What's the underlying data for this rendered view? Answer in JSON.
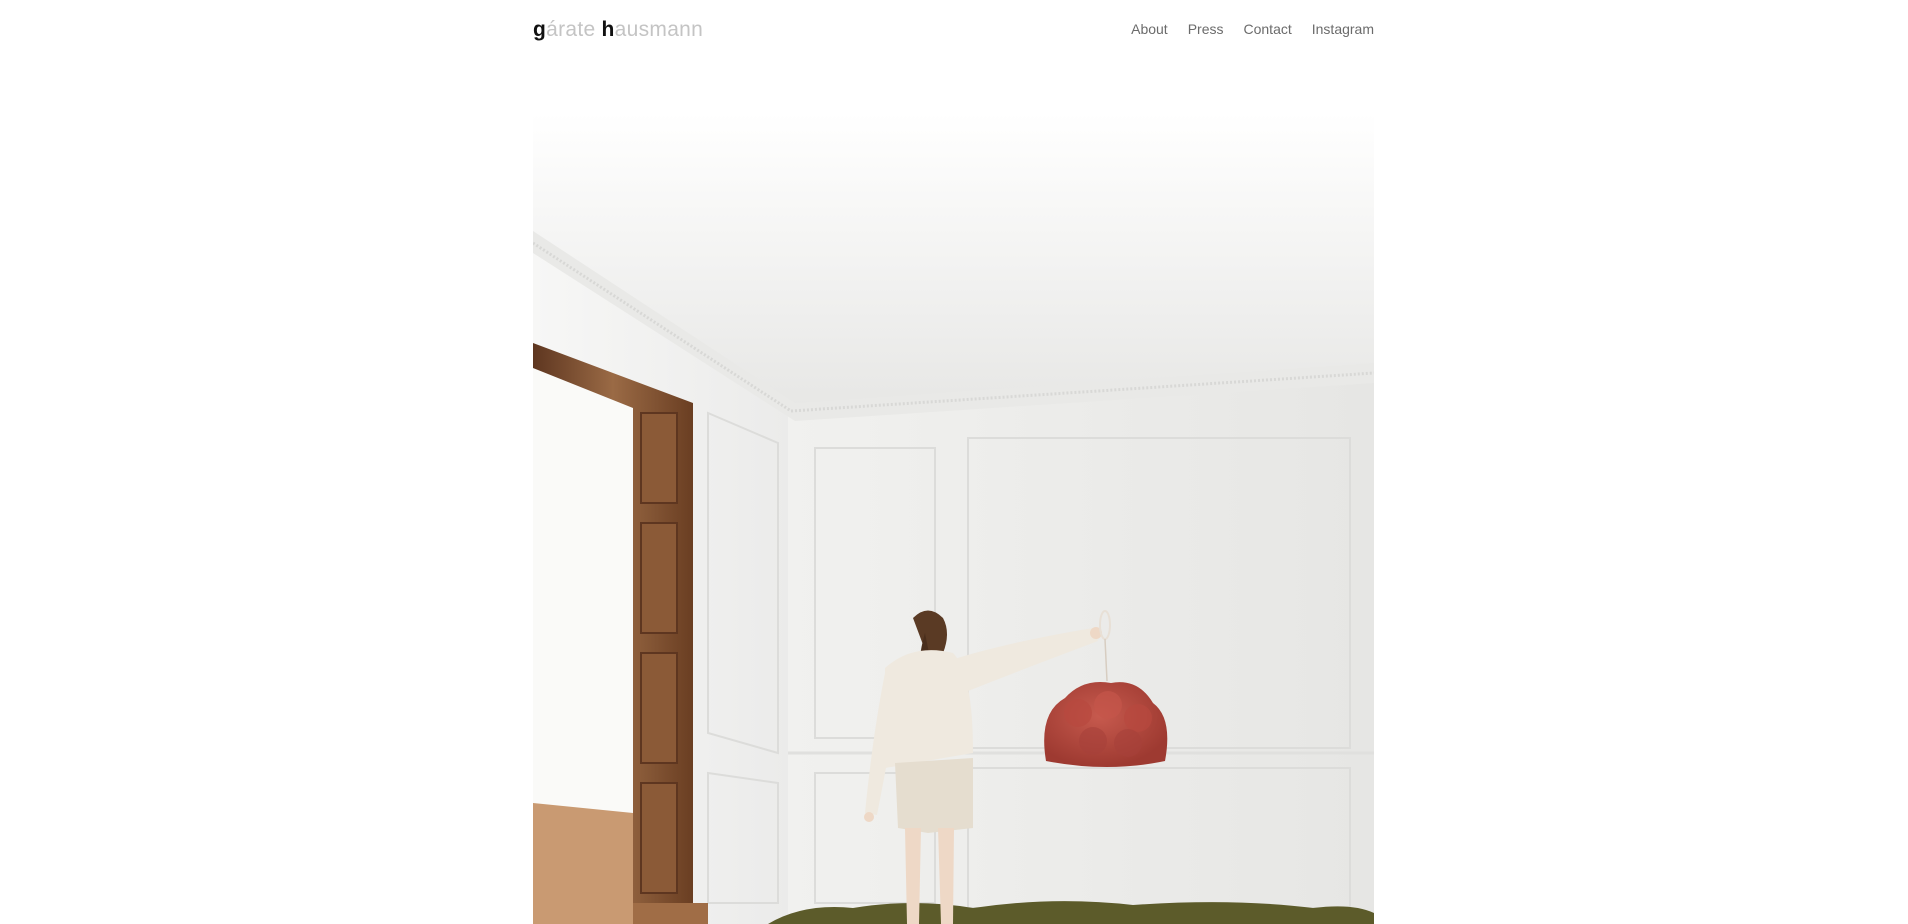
{
  "logo": {
    "first_initial": "g",
    "first_rest": "árate",
    "second_initial": "h",
    "second_rest": "ausmann",
    "initial_color": "#111111",
    "rest_color": "#c4c4c4"
  },
  "nav": {
    "items": [
      {
        "label": "About"
      },
      {
        "label": "Press"
      },
      {
        "label": "Contact"
      },
      {
        "label": "Instagram"
      }
    ],
    "color": "#6b6b6b"
  },
  "hero": {
    "wall_color": "#eeeeec",
    "lamp_color": "#b5493f",
    "door_color": "#7a4a2c",
    "moss_color": "#5c5b2a"
  }
}
